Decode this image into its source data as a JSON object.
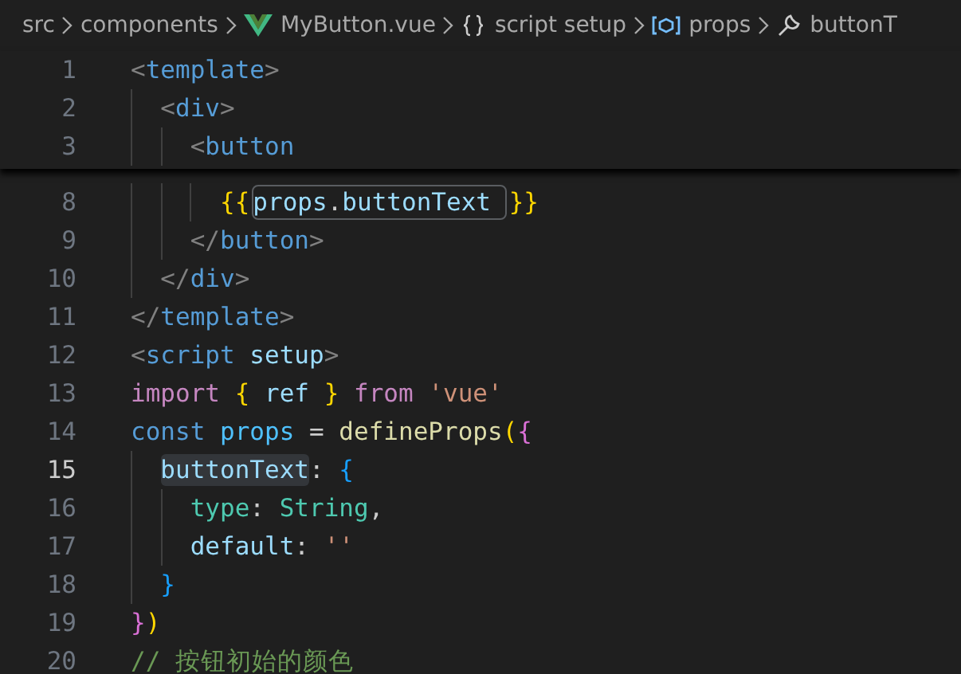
{
  "breadcrumbs": [
    {
      "label": "src",
      "kind": "folder"
    },
    {
      "label": "components",
      "kind": "folder"
    },
    {
      "label": "MyButton.vue",
      "kind": "vue"
    },
    {
      "label": "script setup",
      "kind": "braces"
    },
    {
      "label": "props",
      "kind": "variable"
    },
    {
      "label": "buttonT",
      "kind": "property"
    }
  ],
  "sticky_lines": [
    {
      "number": "1",
      "current": false,
      "tokens": [
        {
          "text": "<",
          "color": "#808080",
          "kind": "text"
        },
        {
          "text": "template",
          "color": "#569cd6",
          "kind": "text"
        },
        {
          "text": ">",
          "color": "#808080",
          "kind": "text"
        }
      ]
    },
    {
      "number": "2",
      "current": false,
      "tokens": [
        {
          "text": "  <",
          "color": "#808080",
          "kind": "text"
        },
        {
          "text": "div",
          "color": "#569cd6",
          "kind": "text"
        },
        {
          "text": ">",
          "color": "#808080",
          "kind": "text"
        }
      ]
    },
    {
      "number": "3",
      "current": false,
      "tokens": [
        {
          "text": "    <",
          "color": "#808080",
          "kind": "text"
        },
        {
          "text": "button",
          "color": "#569cd6",
          "kind": "text"
        }
      ]
    }
  ],
  "lines": [
    {
      "number": "8",
      "current": false,
      "tokens": [
        {
          "text": "      {{",
          "color": "#ffd700",
          "kind": "text"
        },
        {
          "text": "props",
          "color": "#9cdcfe",
          "kind": "box"
        },
        {
          "text": ".",
          "color": "#cccccc",
          "kind": "box"
        },
        {
          "text": "buttonText ",
          "color": "#9cdcfe",
          "kind": "box"
        },
        {
          "text": "}}",
          "color": "#ffd700",
          "kind": "text"
        }
      ]
    },
    {
      "number": "9",
      "current": false,
      "tokens": [
        {
          "text": "    </",
          "color": "#808080",
          "kind": "text"
        },
        {
          "text": "button",
          "color": "#569cd6",
          "kind": "text"
        },
        {
          "text": ">",
          "color": "#808080",
          "kind": "text"
        }
      ]
    },
    {
      "number": "10",
      "current": false,
      "tokens": [
        {
          "text": "  </",
          "color": "#808080",
          "kind": "text"
        },
        {
          "text": "div",
          "color": "#569cd6",
          "kind": "text"
        },
        {
          "text": ">",
          "color": "#808080",
          "kind": "text"
        }
      ]
    },
    {
      "number": "11",
      "current": false,
      "tokens": [
        {
          "text": "</",
          "color": "#808080",
          "kind": "text"
        },
        {
          "text": "template",
          "color": "#569cd6",
          "kind": "text"
        },
        {
          "text": ">",
          "color": "#808080",
          "kind": "text"
        }
      ]
    },
    {
      "number": "12",
      "current": false,
      "tokens": [
        {
          "text": "<",
          "color": "#808080",
          "kind": "text"
        },
        {
          "text": "script",
          "color": "#569cd6",
          "kind": "text"
        },
        {
          "text": " setup",
          "color": "#9cdcfe",
          "kind": "text"
        },
        {
          "text": ">",
          "color": "#808080",
          "kind": "text"
        }
      ]
    },
    {
      "number": "13",
      "current": false,
      "tokens": [
        {
          "text": "import",
          "color": "#c586c0",
          "kind": "text"
        },
        {
          "text": " {",
          "color": "#ffd700",
          "kind": "text"
        },
        {
          "text": " ref ",
          "color": "#9cdcfe",
          "kind": "text"
        },
        {
          "text": "}",
          "color": "#ffd700",
          "kind": "text"
        },
        {
          "text": " from ",
          "color": "#c586c0",
          "kind": "text"
        },
        {
          "text": "'vue'",
          "color": "#ce9178",
          "kind": "text"
        }
      ]
    },
    {
      "number": "14",
      "current": false,
      "tokens": [
        {
          "text": "const",
          "color": "#569cd6",
          "kind": "text"
        },
        {
          "text": " props ",
          "color": "#4fc1ff",
          "kind": "text"
        },
        {
          "text": "= ",
          "color": "#cccccc",
          "kind": "text"
        },
        {
          "text": "defineProps",
          "color": "#dcdcaa",
          "kind": "text"
        },
        {
          "text": "(",
          "color": "#ffd700",
          "kind": "text"
        },
        {
          "text": "{",
          "color": "#da70d6",
          "kind": "text"
        }
      ]
    },
    {
      "number": "15",
      "current": true,
      "tokens": [
        {
          "text": "  buttonText",
          "color": "#9cdcfe",
          "kind": "fill"
        },
        {
          "text": ": ",
          "color": "#cccccc",
          "kind": "text"
        },
        {
          "text": "{",
          "color": "#179fff",
          "kind": "text"
        }
      ]
    },
    {
      "number": "16",
      "current": false,
      "tokens": [
        {
          "text": "    type",
          "color": "#4ec9b0",
          "kind": "text"
        },
        {
          "text": ": ",
          "color": "#cccccc",
          "kind": "text"
        },
        {
          "text": "String",
          "color": "#4ec9b0",
          "kind": "text"
        },
        {
          "text": ",",
          "color": "#cccccc",
          "kind": "text"
        }
      ]
    },
    {
      "number": "17",
      "current": false,
      "tokens": [
        {
          "text": "    default",
          "color": "#9cdcfe",
          "kind": "text"
        },
        {
          "text": ": ",
          "color": "#cccccc",
          "kind": "text"
        },
        {
          "text": "''",
          "color": "#ce9178",
          "kind": "text"
        }
      ]
    },
    {
      "number": "18",
      "current": false,
      "tokens": [
        {
          "text": "  }",
          "color": "#179fff",
          "kind": "text"
        }
      ]
    },
    {
      "number": "19",
      "current": false,
      "tokens": [
        {
          "text": "}",
          "color": "#da70d6",
          "kind": "text"
        },
        {
          "text": ")",
          "color": "#ffd700",
          "kind": "text"
        }
      ]
    },
    {
      "number": "20",
      "current": false,
      "tokens": [
        {
          "text": "// 按钮初始的颜色",
          "color": "#6a9955",
          "kind": "text"
        }
      ]
    }
  ]
}
